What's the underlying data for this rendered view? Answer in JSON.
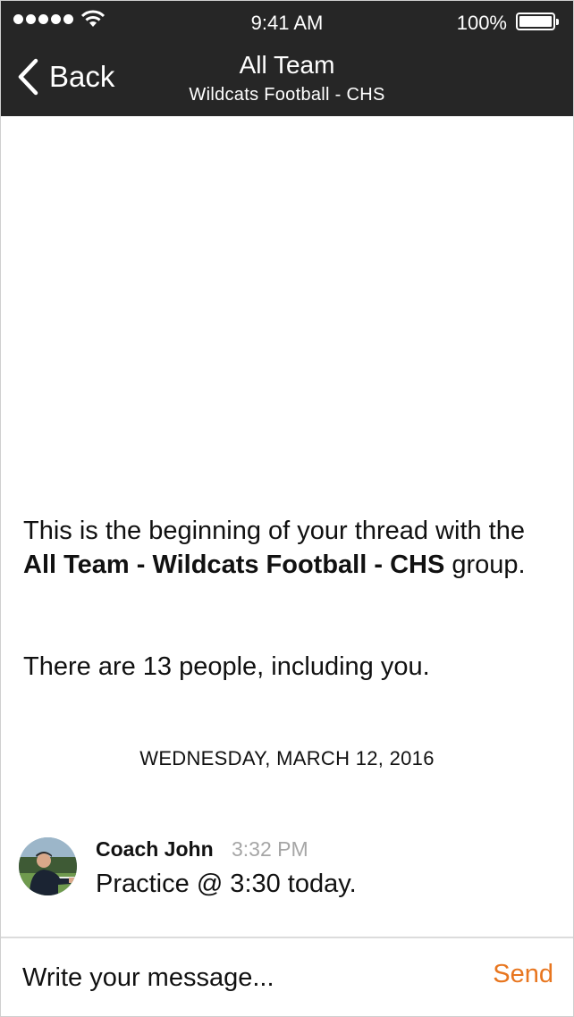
{
  "status_bar": {
    "time": "9:41 AM",
    "battery_percent": "100%",
    "battery_level": 1.0,
    "signal_bars": 5,
    "wifi_icon": "wifi-icon"
  },
  "nav": {
    "back_label": "Back",
    "back_icon": "chevron-left-icon",
    "title": "All Team",
    "subtitle": "Wildcats Football - CHS"
  },
  "thread": {
    "intro_prefix": "This is the beginning of your thread with the ",
    "intro_group": "All Team - Wildcats Football - CHS",
    "intro_suffix": " group.",
    "people_count": "There are 13 people, including you.",
    "date_divider": "WEDNESDAY, MARCH 12, 2016"
  },
  "messages": [
    {
      "sender": "Coach John",
      "time": "3:32 PM",
      "text": "Practice @ 3:30 today.",
      "avatar_icon": "avatar-photo"
    }
  ],
  "composer": {
    "placeholder": "Write your message...",
    "send_label": "Send"
  },
  "colors": {
    "header_bg": "#262626",
    "accent": "#e8761f",
    "timestamp": "#a6a6a6"
  }
}
